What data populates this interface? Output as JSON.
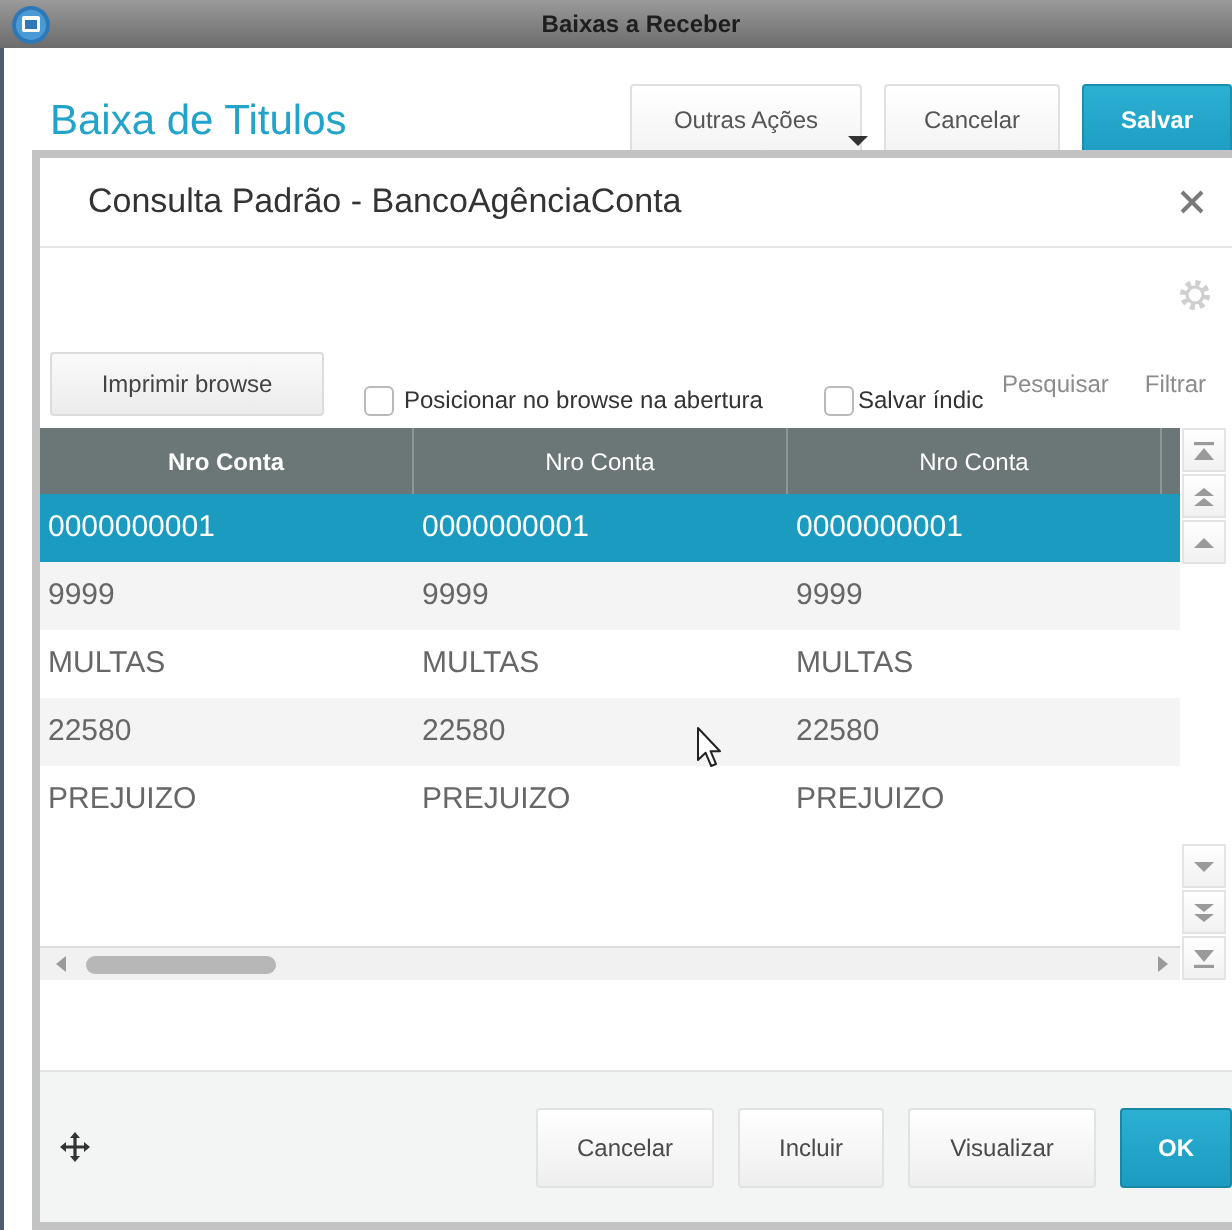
{
  "window": {
    "title": "Baixas a Receber"
  },
  "page": {
    "title": "Baixa de Titulos",
    "actions": [
      {
        "label": "Outras Ações",
        "kind": "dropdown"
      },
      {
        "label": "Cancelar",
        "kind": "default"
      },
      {
        "label": "Salvar",
        "kind": "primary"
      }
    ]
  },
  "dialog": {
    "title": "Consulta Padrão - BancoAgênciaConta",
    "toolbar": {
      "print_button": "Imprimir browse",
      "options": [
        {
          "label": "Posicionar no browse na abertura",
          "checked": false
        },
        {
          "label": "Salvar índic",
          "checked": false
        }
      ],
      "links": [
        "Pesquisar",
        "Filtrar"
      ]
    },
    "table": {
      "columns": [
        {
          "label": "Nro Conta",
          "sorted": true
        },
        {
          "label": "Nro Conta",
          "sorted": false
        },
        {
          "label": "Nro Conta",
          "sorted": false
        }
      ],
      "rows": [
        {
          "cells": [
            "0000000001",
            "0000000001",
            "0000000001"
          ],
          "selected": true
        },
        {
          "cells": [
            "9999",
            "9999",
            "9999"
          ],
          "selected": false
        },
        {
          "cells": [
            "MULTAS",
            "MULTAS",
            "MULTAS"
          ],
          "selected": false
        },
        {
          "cells": [
            "22580",
            "22580",
            "22580"
          ],
          "selected": false
        },
        {
          "cells": [
            "PREJUIZO",
            "PREJUIZO",
            "PREJUIZO"
          ],
          "selected": false
        }
      ]
    },
    "buttons": [
      {
        "label": "Cancelar",
        "kind": "default"
      },
      {
        "label": "Incluir",
        "kind": "default"
      },
      {
        "label": "Visualizar",
        "kind": "default"
      },
      {
        "label": "OK",
        "kind": "primary"
      }
    ]
  }
}
